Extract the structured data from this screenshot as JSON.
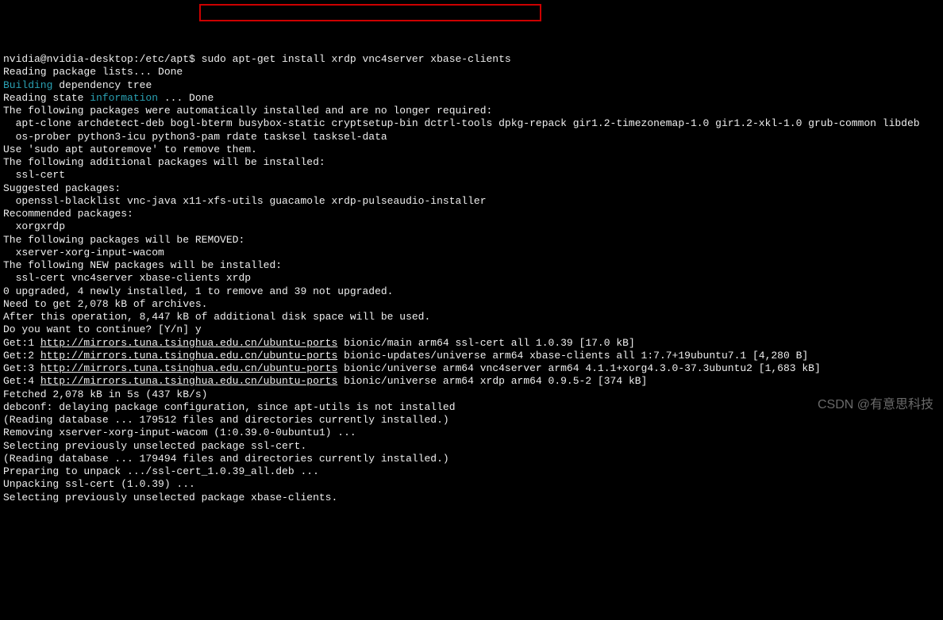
{
  "terminal": {
    "prompt_partial": "nvidia@nvidia-desktop:/etc/apt$",
    "command": " sudo apt-get install xrdp vnc4server xbase-clients",
    "line_reading_lists": "Reading package lists... Done",
    "building": "Building",
    "dep_tree": " dependency tree",
    "reading_state": "Reading state ",
    "information": "information",
    "reading_done": " ... Done",
    "auto_installed_msg": "The following packages were automatically installed and are no longer required:",
    "auto_pkg_line1": "  apt-clone archdetect-deb bogl-bterm busybox-static cryptsetup-bin dctrl-tools dpkg-repack gir1.2-timezonemap-1.0 gir1.2-xkl-1.0 grub-common libdeb",
    "auto_pkg_line2": "  os-prober python3-icu python3-pam rdate tasksel tasksel-data",
    "autoremove_msg": "Use 'sudo apt autoremove' to remove them.",
    "additional_msg": "The following additional packages will be installed:",
    "additional_pkgs": "  ssl-cert",
    "suggested_msg": "Suggested packages:",
    "suggested_pkgs": "  openssl-blacklist vnc-java x11-xfs-utils guacamole xrdp-pulseaudio-installer",
    "recommended_msg": "Recommended packages:",
    "recommended_pkgs": "  xorgxrdp",
    "removed_msg": "The following packages will be REMOVED:",
    "removed_pkgs": "  xserver-xorg-input-wacom",
    "new_msg": "The following NEW packages will be installed:",
    "new_pkgs": "  ssl-cert vnc4server xbase-clients xrdp",
    "upgrade_summary": "0 upgraded, 4 newly installed, 1 to remove and 39 not upgraded.",
    "need_get": "Need to get 2,078 kB of archives.",
    "disk_space": "After this operation, 8,447 kB of additional disk space will be used.",
    "continue_prompt": "Do you want to continue? [Y/n] y",
    "get1_prefix": "Get:1 ",
    "get1_url": "http://mirrors.tuna.tsinghua.edu.cn/ubuntu-ports",
    "get1_suffix": " bionic/main arm64 ssl-cert all 1.0.39 [17.0 kB]",
    "get2_prefix": "Get:2 ",
    "get2_url": "http://mirrors.tuna.tsinghua.edu.cn/ubuntu-ports",
    "get2_suffix": " bionic-updates/universe arm64 xbase-clients all 1:7.7+19ubuntu7.1 [4,280 B]",
    "get3_prefix": "Get:3 ",
    "get3_url": "http://mirrors.tuna.tsinghua.edu.cn/ubuntu-ports",
    "get3_suffix": " bionic/universe arm64 vnc4server arm64 4.1.1+xorg4.3.0-37.3ubuntu2 [1,683 kB]",
    "get4_prefix": "Get:4 ",
    "get4_url": "http://mirrors.tuna.tsinghua.edu.cn/ubuntu-ports",
    "get4_suffix": " bionic/universe arm64 xrdp arm64 0.9.5-2 [374 kB]",
    "fetched": "Fetched 2,078 kB in 5s (437 kB/s)",
    "debconf": "debconf: delaying package configuration, since apt-utils is not installed",
    "reading_db1": "(Reading database ... 179512 files and directories currently installed.)",
    "removing": "Removing xserver-xorg-input-wacom (1:0.39.0-0ubuntu1) ...",
    "selecting1": "Selecting previously unselected package ssl-cert.",
    "reading_db2": "(Reading database ... 179494 files and directories currently installed.)",
    "preparing": "Preparing to unpack .../ssl-cert_1.0.39_all.deb ...",
    "unpacking": "Unpacking ssl-cert (1.0.39) ...",
    "selecting2": "Selecting previously unselected package xbase-clients."
  },
  "watermark": "CSDN @有意思科技"
}
